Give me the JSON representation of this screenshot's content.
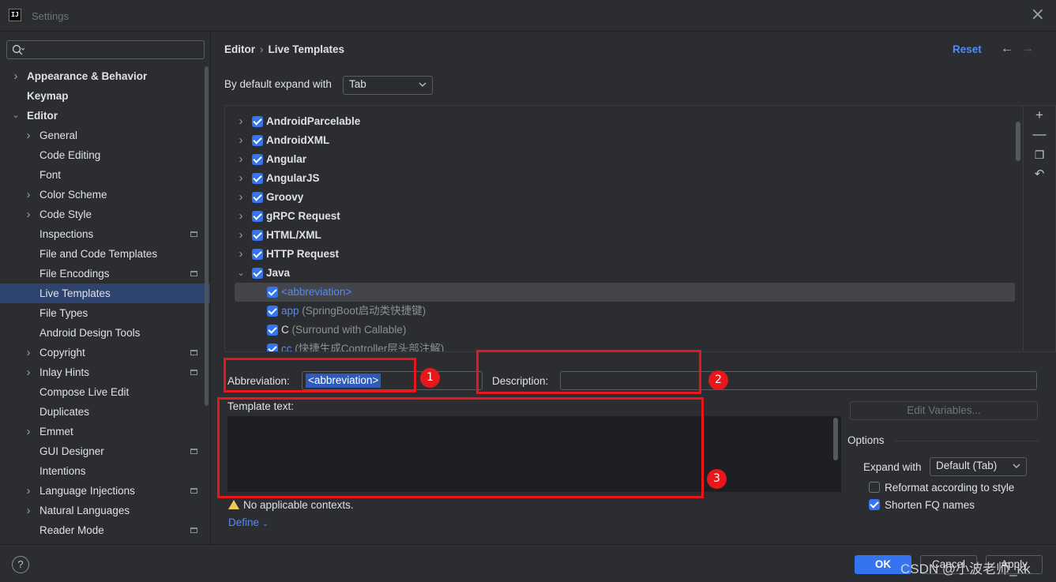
{
  "window": {
    "title": "Settings",
    "logo_text": "IJ"
  },
  "search": {
    "placeholder": "",
    "value": ""
  },
  "sidebar": {
    "items": [
      {
        "label": "Appearance & Behavior",
        "level": 0,
        "chevron": "right",
        "bold": true
      },
      {
        "label": "Keymap",
        "level": 0,
        "chevron": "none",
        "bold": true
      },
      {
        "label": "Editor",
        "level": 0,
        "chevron": "down",
        "bold": true
      },
      {
        "label": "General",
        "level": 1,
        "chevron": "right"
      },
      {
        "label": "Code Editing",
        "level": 1,
        "chevron": "none"
      },
      {
        "label": "Font",
        "level": 1,
        "chevron": "none"
      },
      {
        "label": "Color Scheme",
        "level": 1,
        "chevron": "right"
      },
      {
        "label": "Code Style",
        "level": 1,
        "chevron": "right"
      },
      {
        "label": "Inspections",
        "level": 1,
        "chevron": "none",
        "project": true
      },
      {
        "label": "File and Code Templates",
        "level": 1,
        "chevron": "none"
      },
      {
        "label": "File Encodings",
        "level": 1,
        "chevron": "none",
        "project": true
      },
      {
        "label": "Live Templates",
        "level": 1,
        "chevron": "none",
        "selected": true
      },
      {
        "label": "File Types",
        "level": 1,
        "chevron": "none"
      },
      {
        "label": "Android Design Tools",
        "level": 1,
        "chevron": "none"
      },
      {
        "label": "Copyright",
        "level": 1,
        "chevron": "right",
        "project": true
      },
      {
        "label": "Inlay Hints",
        "level": 1,
        "chevron": "right",
        "project": true
      },
      {
        "label": "Compose Live Edit",
        "level": 1,
        "chevron": "none"
      },
      {
        "label": "Duplicates",
        "level": 1,
        "chevron": "none"
      },
      {
        "label": "Emmet",
        "level": 1,
        "chevron": "right"
      },
      {
        "label": "GUI Designer",
        "level": 1,
        "chevron": "none",
        "project": true
      },
      {
        "label": "Intentions",
        "level": 1,
        "chevron": "none"
      },
      {
        "label": "Language Injections",
        "level": 1,
        "chevron": "right",
        "project": true
      },
      {
        "label": "Natural Languages",
        "level": 1,
        "chevron": "right"
      },
      {
        "label": "Reader Mode",
        "level": 1,
        "chevron": "none",
        "project": true
      }
    ]
  },
  "header": {
    "breadcrumb_parent": "Editor",
    "breadcrumb_sep": "›",
    "breadcrumb_current": "Live Templates",
    "reset_label": "Reset",
    "back_arrow": "←",
    "forward_arrow": "→"
  },
  "expand": {
    "label": "By default expand with",
    "value": "Tab"
  },
  "templates": [
    {
      "kind": "group",
      "name": "AndroidParcelable",
      "expanded": false
    },
    {
      "kind": "group",
      "name": "AndroidXML",
      "expanded": false
    },
    {
      "kind": "group",
      "name": "Angular",
      "expanded": false
    },
    {
      "kind": "group",
      "name": "AngularJS",
      "expanded": false
    },
    {
      "kind": "group",
      "name": "Groovy",
      "expanded": false
    },
    {
      "kind": "group",
      "name": "gRPC Request",
      "expanded": false
    },
    {
      "kind": "group",
      "name": "HTML/XML",
      "expanded": false
    },
    {
      "kind": "group",
      "name": "HTTP Request",
      "expanded": false
    },
    {
      "kind": "group",
      "name": "Java",
      "expanded": true
    },
    {
      "kind": "item",
      "abbr": "<abbreviation>",
      "desc": "",
      "selected": true,
      "link": true
    },
    {
      "kind": "item",
      "abbr": "app",
      "desc": " (SpringBoot启动类快捷键)",
      "link": true
    },
    {
      "kind": "item",
      "abbr": "C",
      "desc": " (Surround with Callable)",
      "link": false
    },
    {
      "kind": "item",
      "abbr": "cc",
      "desc": " (快捷生成Controller层头部注解)",
      "link": true
    }
  ],
  "form": {
    "abbreviation_label": "Abbreviation:",
    "abbreviation_value": "<abbreviation>",
    "description_label": "Description:",
    "description_value": "",
    "template_text_label": "Template text:",
    "template_text_value": "",
    "edit_variables_label": "Edit Variables...",
    "warning_text": "No applicable contexts.",
    "define_label": "Define"
  },
  "options": {
    "title": "Options",
    "expand_with_label": "Expand with",
    "expand_with_value": "Default (Tab)",
    "reformat_label": "Reformat according to style",
    "reformat_checked": false,
    "shorten_label": "Shorten FQ names",
    "shorten_checked": true
  },
  "footer": {
    "help_label": "?",
    "ok_label": "OK",
    "cancel_label": "Cancel",
    "apply_label": "Apply",
    "watermark": "CSDN @小波老师_kk"
  },
  "annotations": [
    "1",
    "2",
    "3"
  ],
  "colors": {
    "accent": "#3574f0",
    "link": "#548af7",
    "selection": "#2e436e",
    "annotation": "#e8171c"
  }
}
